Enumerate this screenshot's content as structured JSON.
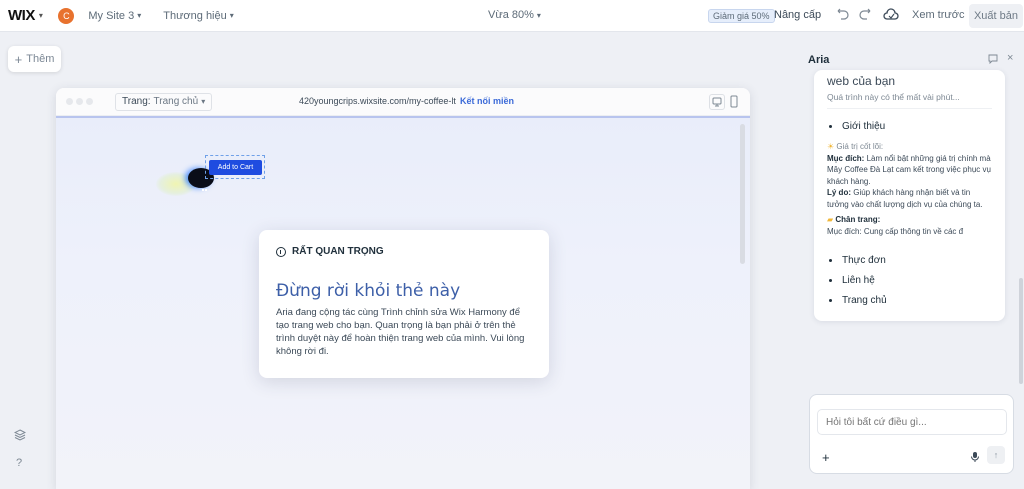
{
  "topbar": {
    "logo": "WIX",
    "avatar_initial": "C",
    "site_name": "My Site 3",
    "brand_menu": "Thương hiệu",
    "zoom": "Vừa 80%",
    "discount_badge": "Giảm giá 50%",
    "upgrade": "Nâng cấp",
    "preview": "Xem trước",
    "publish": "Xuất bản"
  },
  "left": {
    "add": "Thêm",
    "help": "?"
  },
  "browser": {
    "page_label": "Trang:",
    "page_value": "Trang chủ",
    "url": "420youngcrips.wixsite.com/my-coffee-lt",
    "connect_domain": "Kết nối miền"
  },
  "canvas": {
    "cart_button": "Add to Cart"
  },
  "modal": {
    "heading": "RẤT QUAN TRỌNG",
    "title": "Đừng rời khỏi thẻ này",
    "body": "Aria đang cộng tác cùng Trình chỉnh sửa Wix Harmony để tạo trang web cho bạn. Quan trọng là bạn phải ở trên thẻ trình duyệt này để hoàn thiện trang web của mình. Vui lòng không rời đi."
  },
  "aria": {
    "header": "Aria",
    "card_title": "web của bạn",
    "card_sub": "Quá trình này có thể mất vài phút...",
    "item_intro": "Giới thiệu",
    "core_values_label": "Giá trị cốt lõi:",
    "purpose_label": "Mục đích:",
    "purpose_text": "Làm nổi bật những giá trị chính mà Mây Coffee Đà Lạt cam kết trong việc phục vụ khách hàng.",
    "reason_label": "Lý do:",
    "reason_text": "Giúp khách hàng nhận biết và tin tưởng vào chất lượng dịch vụ của chúng ta.",
    "footer_label": "Chân trang:",
    "footer_purpose_label": "Mục đích:",
    "footer_purpose_text": "Cung cấp thông tin về các đ",
    "item_menu": "Thực đơn",
    "item_contact": "Liên hệ",
    "item_home": "Trang chủ",
    "chat_placeholder": "Hỏi tôi bất cứ điều gì..."
  }
}
